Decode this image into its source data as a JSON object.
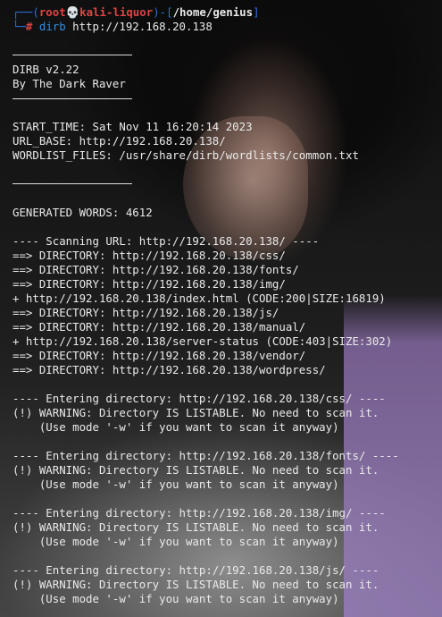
{
  "prompt": {
    "corner_top": "┌──(",
    "user": "root",
    "skull": "💀",
    "host": "kali-liquor",
    "sep": ")-[",
    "path": "/home/genius",
    "close": "]",
    "corner_bottom": "└─",
    "hash": "#",
    "command": "dirb",
    "argument": "http://192.168.20.138"
  },
  "banner": {
    "title": "DIRB v2.22",
    "author": "By The Dark Raver"
  },
  "info": {
    "start_time": "START_TIME: Sat Nov 11 16:20:14 2023",
    "url_base": "URL_BASE: http://192.168.20.138/",
    "wordlist": "WORDLIST_FILES: /usr/share/dirb/wordlists/common.txt"
  },
  "generated": "GENERATED WORDS: 4612",
  "scan": {
    "header": "---- Scanning URL: http://192.168.20.138/ ----",
    "results": [
      "==> DIRECTORY: http://192.168.20.138/css/",
      "==> DIRECTORY: http://192.168.20.138/fonts/",
      "==> DIRECTORY: http://192.168.20.138/img/",
      "+ http://192.168.20.138/index.html (CODE:200|SIZE:16819)",
      "==> DIRECTORY: http://192.168.20.138/js/",
      "==> DIRECTORY: http://192.168.20.138/manual/",
      "+ http://192.168.20.138/server-status (CODE:403|SIZE:302)",
      "==> DIRECTORY: http://192.168.20.138/vendor/",
      "==> DIRECTORY: http://192.168.20.138/wordpress/"
    ]
  },
  "entering": [
    {
      "header": "---- Entering directory: http://192.168.20.138/css/ ----",
      "warning": "(!) WARNING: Directory IS LISTABLE. No need to scan it.",
      "hint": "    (Use mode '-w' if you want to scan it anyway)"
    },
    {
      "header": "---- Entering directory: http://192.168.20.138/fonts/ ----",
      "warning": "(!) WARNING: Directory IS LISTABLE. No need to scan it.",
      "hint": "    (Use mode '-w' if you want to scan it anyway)"
    },
    {
      "header": "---- Entering directory: http://192.168.20.138/img/ ----",
      "warning": "(!) WARNING: Directory IS LISTABLE. No need to scan it.",
      "hint": "    (Use mode '-w' if you want to scan it anyway)"
    },
    {
      "header": "---- Entering directory: http://192.168.20.138/js/ ----",
      "warning": "(!) WARNING: Directory IS LISTABLE. No need to scan it.",
      "hint": "    (Use mode '-w' if you want to scan it anyway)"
    }
  ]
}
